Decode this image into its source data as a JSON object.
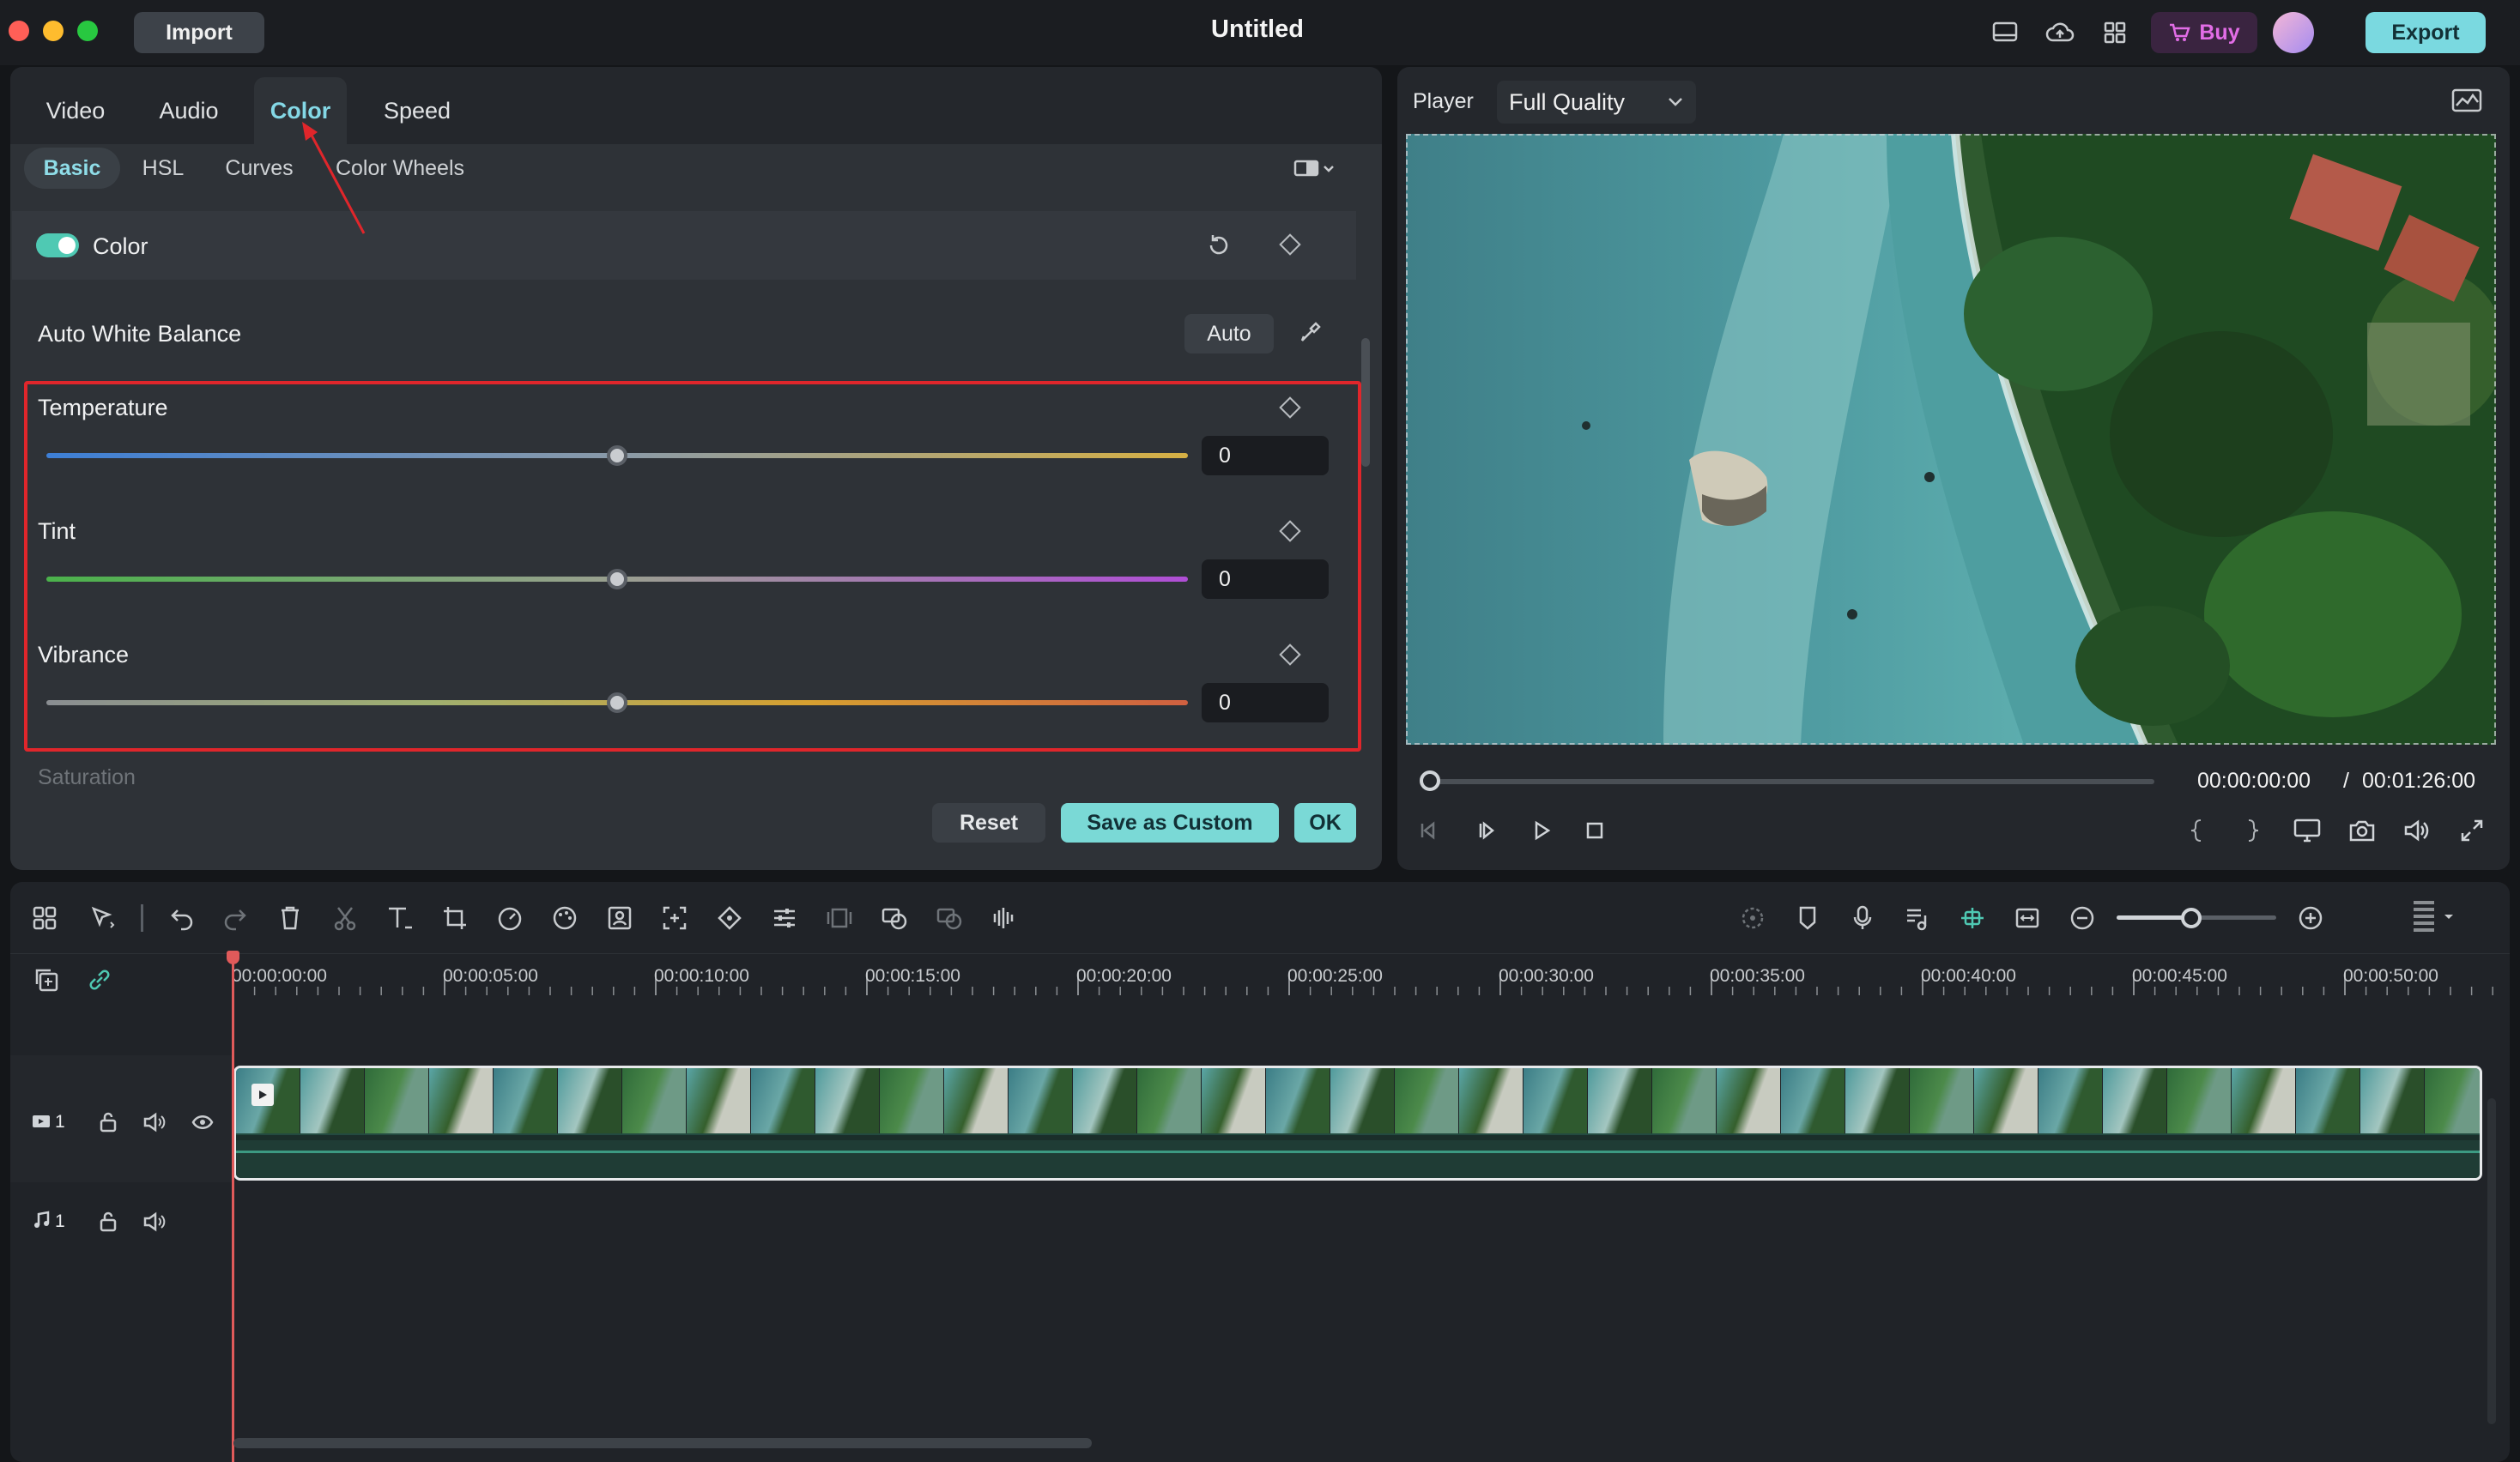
{
  "window": {
    "title": "Untitled",
    "import_label": "Import",
    "buy_label": "Buy",
    "export_label": "Export"
  },
  "titlebar_icons": [
    "layout-icon",
    "cloud-upload-icon",
    "grid-apps-icon"
  ],
  "colors": {
    "accent": "#7ad9e0",
    "active_tab": "#84d8e6",
    "annotation_red": "#e0262b",
    "track_green": "#2f7f6a",
    "playhead": "#e05a5a"
  },
  "editor": {
    "tabs": [
      "Video",
      "Audio",
      "Color",
      "Speed"
    ],
    "active_tab": "Color",
    "subtabs": [
      "Basic",
      "HSL",
      "Curves",
      "Color Wheels"
    ],
    "active_subtab": "Basic",
    "color_toggle": {
      "label": "Color",
      "on": true
    },
    "auto_white_balance": {
      "label": "Auto White Balance",
      "button": "Auto"
    },
    "sliders": [
      {
        "label": "Temperature",
        "value": "0",
        "position": 0.5
      },
      {
        "label": "Tint",
        "value": "0",
        "position": 0.5
      },
      {
        "label": "Vibrance",
        "value": "0",
        "position": 0.5
      }
    ],
    "cut_off_label": "Saturation",
    "buttons": {
      "reset": "Reset",
      "save_custom": "Save as Custom",
      "ok": "OK"
    }
  },
  "player": {
    "label": "Player",
    "quality": "Full Quality",
    "current_time": "00:00:00:00",
    "separator": "/",
    "total_time": "00:01:26:00",
    "progress": 0
  },
  "timeline": {
    "ruler": [
      "00:00:00:00",
      "00:00:05:00",
      "00:00:10:00",
      "00:00:15:00",
      "00:00:20:00",
      "00:00:25:00",
      "00:00:30:00",
      "00:00:35:00",
      "00:00:40:00",
      "00:00:45:00",
      "00:00:50:00"
    ],
    "video_track": {
      "number": "1"
    },
    "audio_track": {
      "number": "1"
    },
    "zoom_level": 0.47
  }
}
